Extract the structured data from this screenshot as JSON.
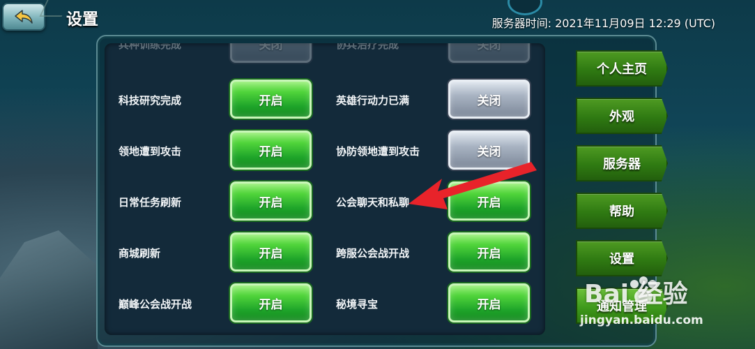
{
  "header": {
    "title": "设置",
    "server_time": "服务器时间: 2021年11月09日 12:29 (UTC)"
  },
  "settings": {
    "rows": [
      {
        "left_label": "兵种训练完成",
        "left_state": "关闭",
        "right_label": "协兵治疗完成",
        "right_state": "关闭",
        "clipped": true
      },
      {
        "left_label": "科技研究完成",
        "left_state": "开启",
        "right_label": "英雄行动力已满",
        "right_state": "关闭"
      },
      {
        "left_label": "领地遭到攻击",
        "left_state": "开启",
        "right_label": "协防领地遭到攻击",
        "right_state": "关闭"
      },
      {
        "left_label": "日常任务刷新",
        "left_state": "开启",
        "right_label": "公会聊天和私聊",
        "right_state": "开启"
      },
      {
        "left_label": "商城刷新",
        "left_state": "开启",
        "right_label": "跨服公会战开战",
        "right_state": "开启"
      },
      {
        "left_label": "巅峰公会战开战",
        "left_state": "开启",
        "right_label": "秘境寻宝",
        "right_state": "开启"
      }
    ]
  },
  "nav": {
    "items": [
      {
        "label": "个人主页"
      },
      {
        "label": "外观"
      },
      {
        "label": "服务器"
      },
      {
        "label": "帮助"
      },
      {
        "label": "设置"
      },
      {
        "label": "通知管理"
      }
    ],
    "selected": "通知管理"
  },
  "watermark": {
    "logo": "Bai 经验",
    "url": "jingyan.baidu.com"
  },
  "icons": {
    "back": "back-arrow-icon"
  },
  "colors": {
    "toggle_on": "#2fbf2a",
    "toggle_off": "#a8b3c2",
    "nav_green": "#3a8a18",
    "annotation_red": "#e8232a"
  }
}
